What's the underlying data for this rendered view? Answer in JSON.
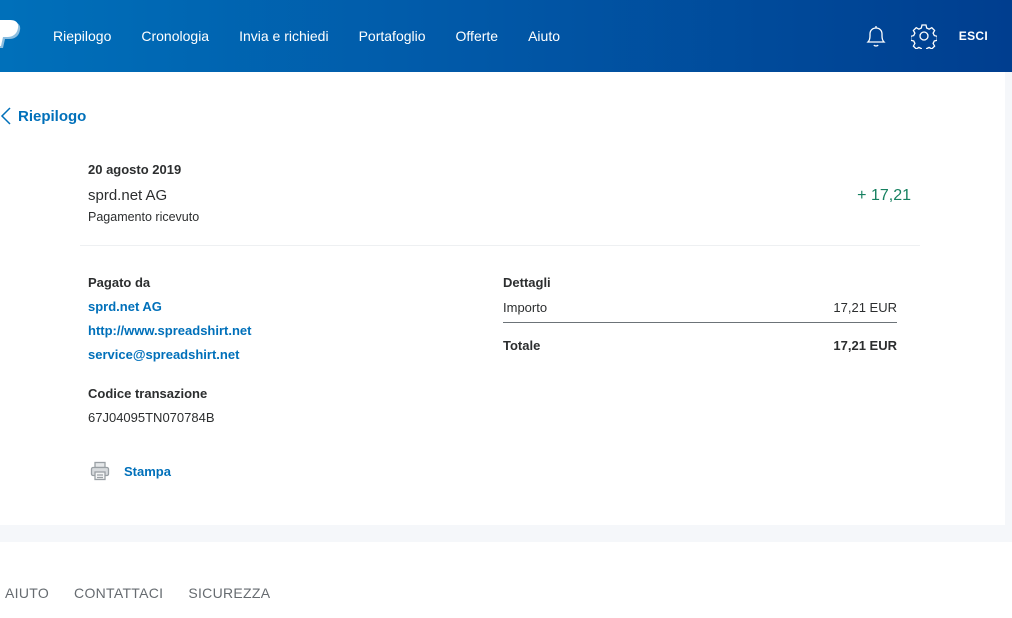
{
  "header": {
    "nav": [
      "Riepilogo",
      "Cronologia",
      "Invia e richiedi",
      "Portafoglio",
      "Offerte",
      "Aiuto"
    ],
    "logout": "ESCI",
    "icons": {
      "logo": "paypal-logo",
      "notifications": "bell-icon",
      "settings": "gear-icon"
    },
    "colors": {
      "gradient_start": "#0070ba",
      "gradient_end": "#003e8f"
    }
  },
  "back": {
    "label": "Riepilogo"
  },
  "transaction": {
    "date": "20 agosto 2019",
    "name": "sprd.net AG",
    "status": "Pagamento ricevuto",
    "amount": "+ 17,21",
    "amount_color": "#168060"
  },
  "paid_by": {
    "heading": "Pagato da",
    "name": "sprd.net AG",
    "website": "http://www.spreadshirt.net",
    "email": "service@spreadshirt.net"
  },
  "transaction_code": {
    "heading": "Codice transazione",
    "value": "67J04095TN070784B"
  },
  "details": {
    "heading": "Dettagli",
    "amount_label": "Importo",
    "amount_value": "17,21 EUR",
    "total_label": "Totale",
    "total_value": "17,21 EUR"
  },
  "print": {
    "label": "Stampa"
  },
  "footer": [
    "AIUTO",
    "CONTATTACI",
    "SICUREZZA"
  ],
  "accent_color": "#0070ba"
}
